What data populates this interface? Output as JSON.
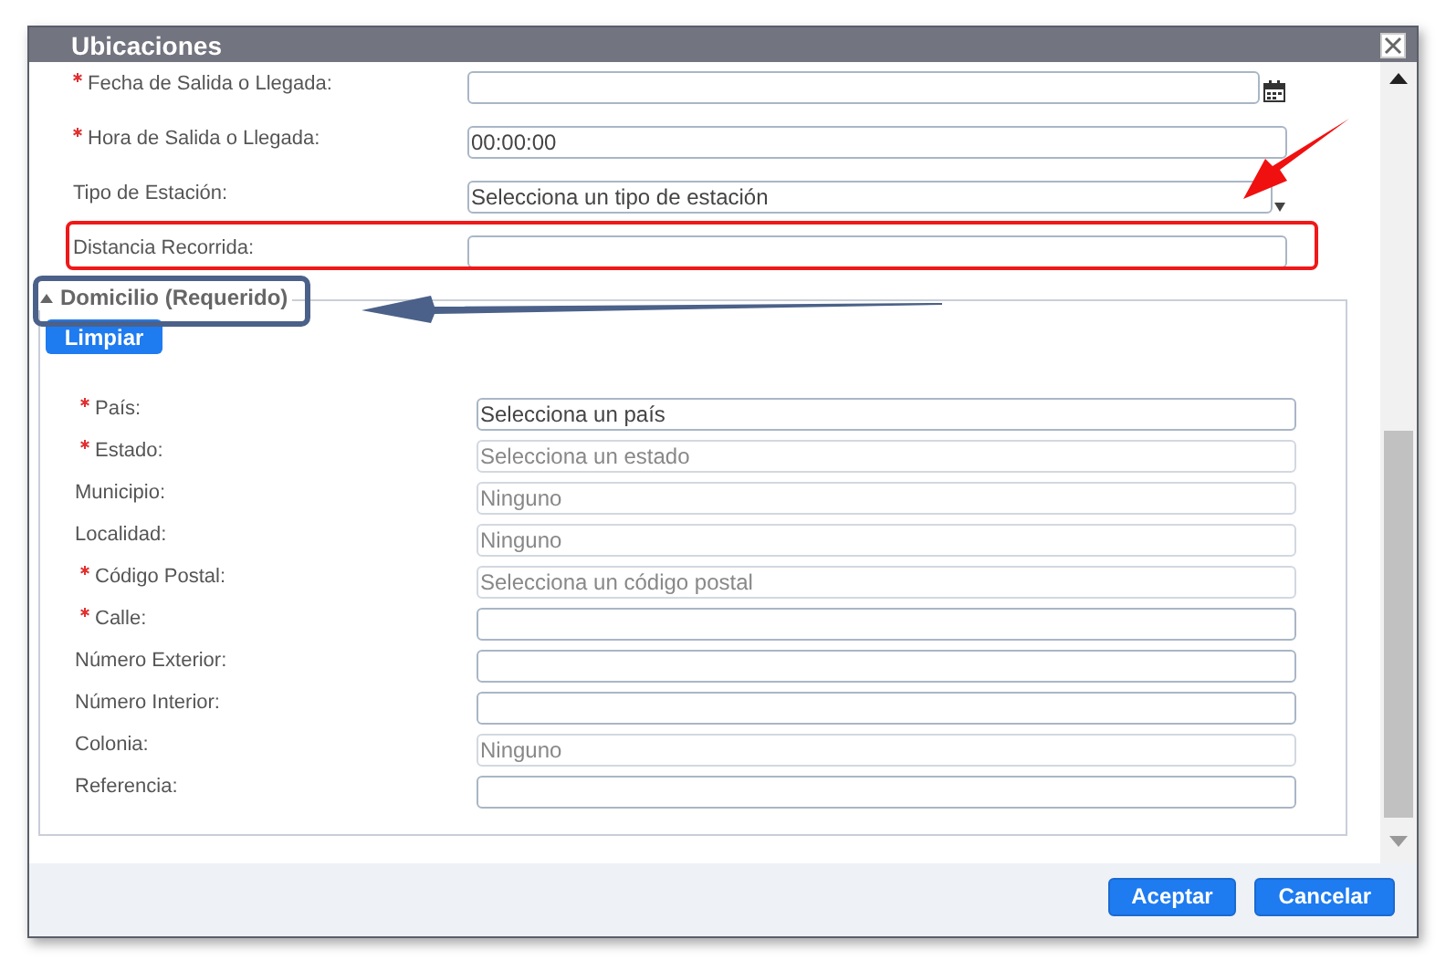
{
  "window": {
    "title": "Ubicaciones"
  },
  "fields": [
    {
      "label": "Fecha de Salida o Llegada:",
      "required": true,
      "kind": "date"
    },
    {
      "label": "Hora de Salida o Llegada:",
      "required": true,
      "kind": "text",
      "value": "00:00:00"
    },
    {
      "label": "Tipo de Estación:",
      "required": false,
      "kind": "select",
      "value": "Selecciona un tipo de estación"
    },
    {
      "label": "Distancia Recorrida:",
      "required": false,
      "kind": "text"
    }
  ],
  "section": {
    "title": "Domicilio (Requerido)",
    "expanded": true,
    "clear_button": "Limpiar",
    "fields": [
      {
        "label": "País:",
        "required": true,
        "disabled": false,
        "value": "Selecciona un país"
      },
      {
        "label": "Estado:",
        "required": true,
        "disabled": true,
        "value": "Selecciona un estado"
      },
      {
        "label": "Municipio:",
        "required": false,
        "disabled": true,
        "value": "Ninguno"
      },
      {
        "label": "Localidad:",
        "required": false,
        "disabled": true,
        "value": "Ninguno"
      },
      {
        "label": "Código Postal:",
        "required": true,
        "disabled": true,
        "value": "Selecciona un código postal"
      },
      {
        "label": "Calle:",
        "required": true,
        "disabled": false
      },
      {
        "label": "Número Exterior:",
        "required": false,
        "disabled": false
      },
      {
        "label": "Número Interior:",
        "required": false,
        "disabled": false
      },
      {
        "label": "Colonia:",
        "required": false,
        "disabled": true,
        "value": "Ninguno"
      },
      {
        "label": "Referencia:",
        "required": false,
        "disabled": false
      }
    ]
  },
  "buttons": [
    "Aceptar",
    "Cancelar"
  ]
}
